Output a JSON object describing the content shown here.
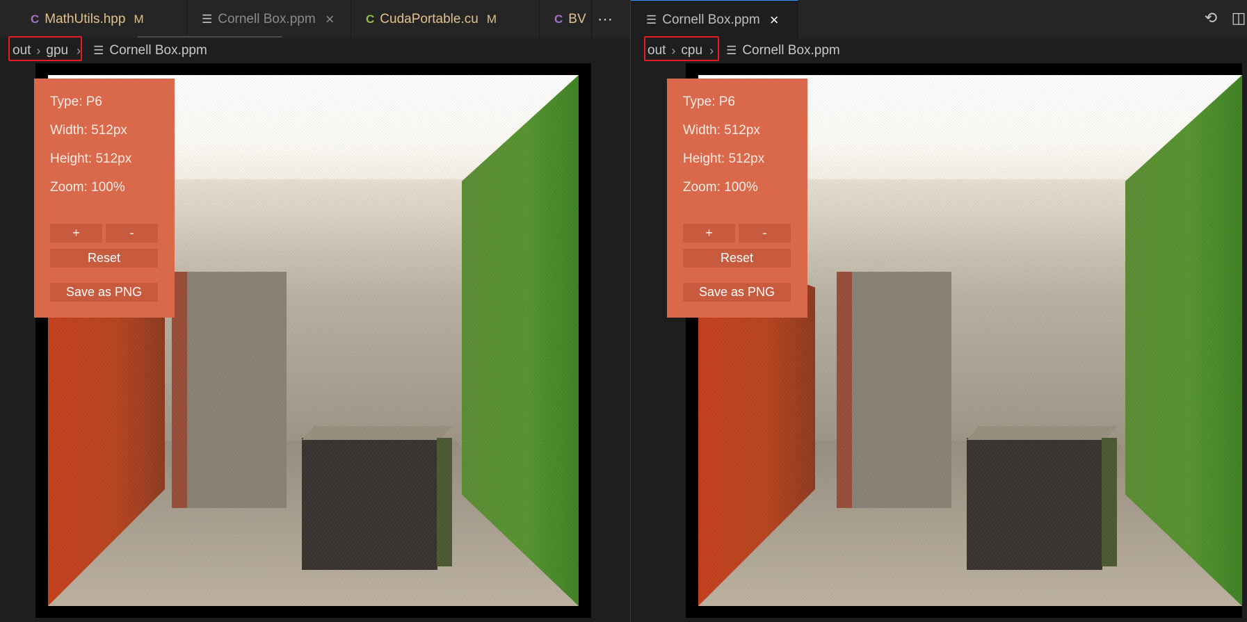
{
  "left_group": {
    "tabs": [
      {
        "icon": "cpp-file-icon",
        "label": "MathUtils.hpp",
        "modified": "M"
      },
      {
        "icon": "ppm-file-icon",
        "label": "Cornell Box.ppm",
        "close": "×"
      },
      {
        "icon": "cuda-file-icon",
        "label": "CudaPortable.cu",
        "modified": "M"
      },
      {
        "icon": "cpp-file-icon",
        "label": "BV"
      }
    ],
    "more_actions": "⋯",
    "breadcrumb": {
      "folder1": "out",
      "folder2": "gpu",
      "file": "Cornell Box.ppm"
    },
    "viewer": {
      "type": "Type: P6",
      "width": "Width: 512px",
      "height": "Height: 512px",
      "zoom": "Zoom: 100%",
      "zoom_in": "+",
      "zoom_out": "-",
      "reset": "Reset",
      "save": "Save as PNG"
    }
  },
  "right_group": {
    "tabs": [
      {
        "icon": "ppm-file-icon",
        "label": "Cornell Box.ppm",
        "close": "×"
      }
    ],
    "actions": {
      "timeline": "history-icon",
      "split": "split-editor-icon"
    },
    "breadcrumb": {
      "folder1": "out",
      "folder2": "cpu",
      "file": "Cornell Box.ppm"
    },
    "viewer": {
      "type": "Type: P6",
      "width": "Width: 512px",
      "height": "Height: 512px",
      "zoom": "Zoom: 100%",
      "zoom_in": "+",
      "zoom_out": "-",
      "reset": "Reset",
      "save": "Save as PNG"
    }
  },
  "colors": {
    "panel_bg": "#d9694a",
    "panel_button": "#c85a3d",
    "highlight_box": "#e51c23",
    "modified": "#e2c08d",
    "red_wall": "#c0401f",
    "green_wall": "#4f8f2a"
  }
}
